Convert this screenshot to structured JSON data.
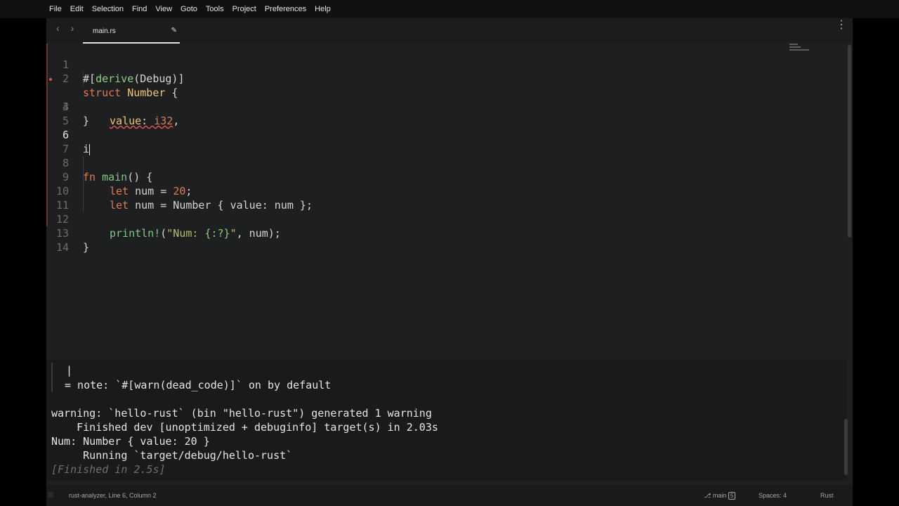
{
  "menu": [
    "File",
    "Edit",
    "Selection",
    "Find",
    "View",
    "Goto",
    "Tools",
    "Project",
    "Preferences",
    "Help"
  ],
  "tabs": {
    "back_icon": "‹",
    "forward_icon": "›",
    "active": "main.rs",
    "modified_icon": "✎",
    "more_icon": "⋮"
  },
  "editor": {
    "line_numbers": [
      "1",
      "2",
      "3",
      "4",
      "5",
      "6",
      "7",
      "8",
      "9",
      "10",
      "11",
      "12",
      "13",
      "14"
    ],
    "current_line": "6",
    "lines": {
      "l1": {
        "a": "#[",
        "b": "derive",
        "c": "(Debug)]"
      },
      "l2": {
        "a": "struct",
        "b": " ",
        "c": "Number",
        "d": " {"
      },
      "l3": {
        "a": "value",
        "b": ": ",
        "c": "i32",
        "d": ","
      },
      "l4": "}",
      "l6": "i",
      "l8": {
        "a": "fn",
        "b": " ",
        "c": "main",
        "d": "() {"
      },
      "l9": {
        "a": "let",
        "b": " num = ",
        "c": "20",
        "d": ";"
      },
      "l10": {
        "a": "let",
        "b": " num = Number { value: num };"
      },
      "l12": {
        "a": "println!",
        "b": "(",
        "c": "\"Num: ",
        "d": "{:?}",
        "e": "\"",
        "f": ", num);"
      },
      "l13": "}"
    }
  },
  "output": {
    "pipe": "|",
    "note": "= note: `#[warn(dead_code)]` on by default",
    "warning": "warning: `hello-rust` (bin \"hello-rust\") generated 1 warning",
    "finished": "    Finished dev [unoptimized + debuginfo] target(s) in 2.03s",
    "result": "Num: Number { value: 20 }",
    "running": "     Running `target/debug/hello-rust`",
    "build_time": "[Finished in 2.5s]"
  },
  "status": {
    "left": "rust-analyzer, Line 6, Column 2",
    "branch_icon": "⎇",
    "branch": "main",
    "branch_badge": "5",
    "spaces": "Spaces: 4",
    "language": "Rust"
  }
}
